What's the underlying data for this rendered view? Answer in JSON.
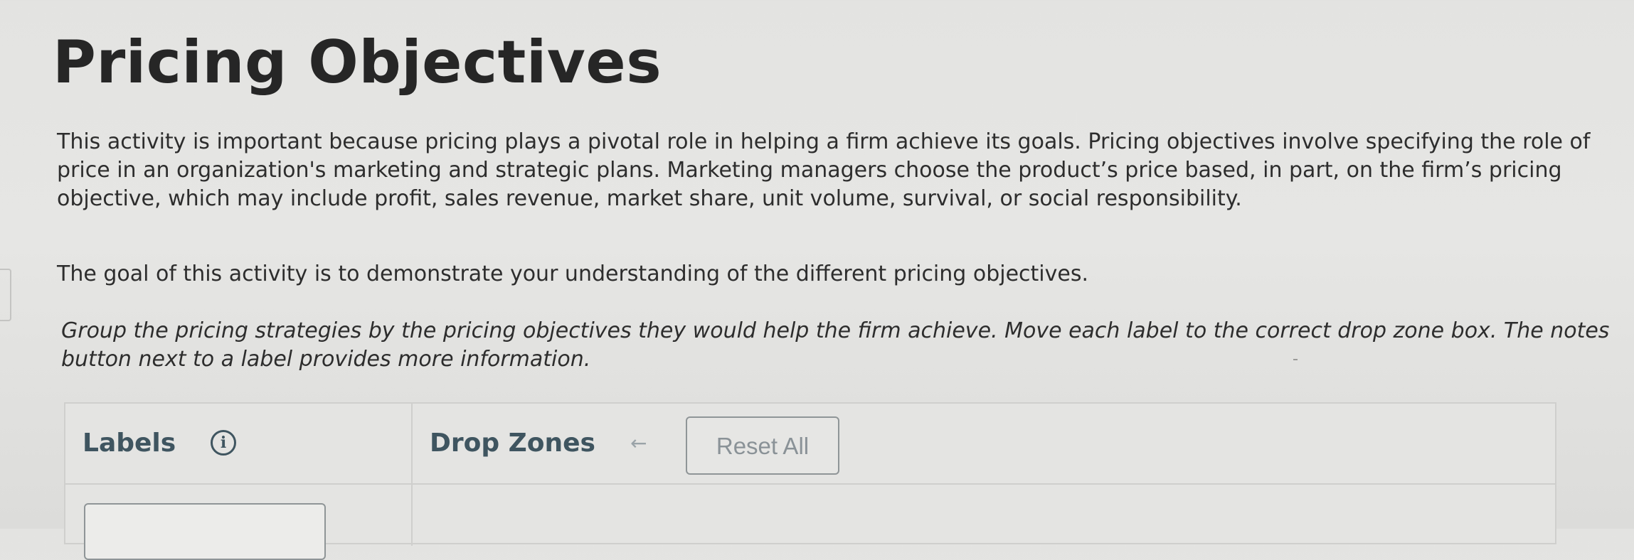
{
  "page": {
    "title": "Pricing Objectives",
    "intro": "This activity is important because pricing plays a pivotal role in helping a firm achieve its goals. Pricing objectives involve specifying the role of price in an organization's marketing and strategic plans. Marketing managers choose the product’s price based, in part, on the firm’s pricing objective, which may include profit, sales revenue, market share, unit volume, survival, or social responsibility.",
    "goal": "The goal of this activity is to demonstrate your understanding of the different pricing objectives.",
    "instructions": "Group the pricing strategies by the pricing objectives they would help the firm achieve. Move each label to the correct drop zone box. The notes button next to a label provides more information."
  },
  "activity": {
    "labels_heading": "Labels",
    "info_icon": "info-icon",
    "info_glyph": "i",
    "dropzones_heading": "Drop Zones",
    "undo_icon": "undo-icon",
    "undo_glyph": "←",
    "reset_button": "Reset All"
  },
  "colors": {
    "heading": "#3f5560",
    "button_text": "#8a9297",
    "border": "#cfcfcd"
  }
}
